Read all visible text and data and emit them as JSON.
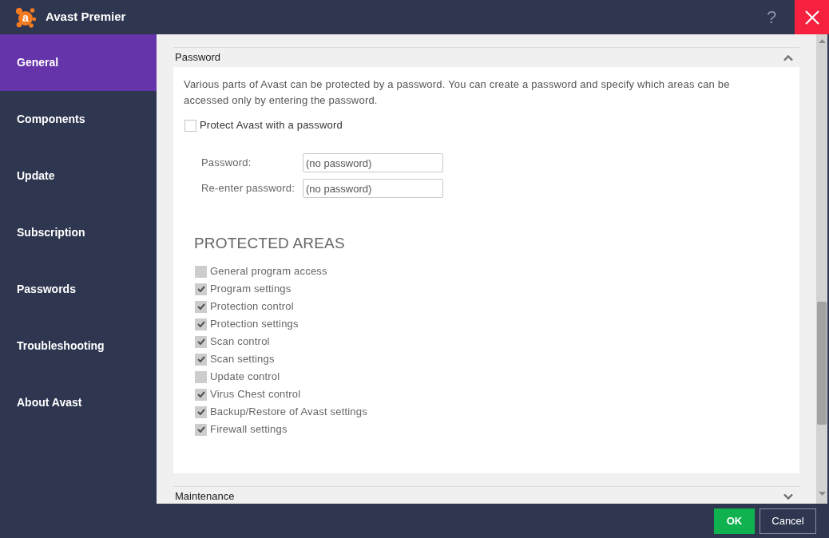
{
  "window": {
    "title": "Avast Premier",
    "logo_letter": "a",
    "help": "?"
  },
  "sidebar": {
    "items": [
      {
        "label": "General",
        "selected": true
      },
      {
        "label": "Components",
        "selected": false
      },
      {
        "label": "Update",
        "selected": false
      },
      {
        "label": "Subscription",
        "selected": false
      },
      {
        "label": "Passwords",
        "selected": false
      },
      {
        "label": "Troubleshooting",
        "selected": false
      },
      {
        "label": "About Avast",
        "selected": false
      }
    ]
  },
  "sections": [
    {
      "title": "Password",
      "expanded": true,
      "description": "Various parts of Avast can be protected by a password. You can create a password and specify which areas can be accessed only by entering the password.",
      "protect_checkbox": {
        "label": "Protect Avast with a password",
        "checked": false
      },
      "fields": [
        {
          "label": "Password:",
          "placeholder": "(no password)"
        },
        {
          "label": "Re-enter password:",
          "placeholder": "(no password)"
        }
      ],
      "protected_areas": {
        "heading": "PROTECTED AREAS",
        "items": [
          {
            "label": "General program access",
            "checked": false
          },
          {
            "label": "Program settings",
            "checked": true
          },
          {
            "label": "Protection control",
            "checked": true
          },
          {
            "label": "Protection settings",
            "checked": true
          },
          {
            "label": "Scan control",
            "checked": true
          },
          {
            "label": "Scan settings",
            "checked": true
          },
          {
            "label": "Update control",
            "checked": false
          },
          {
            "label": "Virus Chest control",
            "checked": true
          },
          {
            "label": "Backup/Restore of Avast settings",
            "checked": true
          },
          {
            "label": "Firewall settings",
            "checked": true
          }
        ]
      }
    },
    {
      "title": "Maintenance",
      "expanded": false
    }
  ],
  "buttons": [
    {
      "label": "OK",
      "kind": "primary"
    },
    {
      "label": "Cancel",
      "kind": "secondary"
    }
  ]
}
